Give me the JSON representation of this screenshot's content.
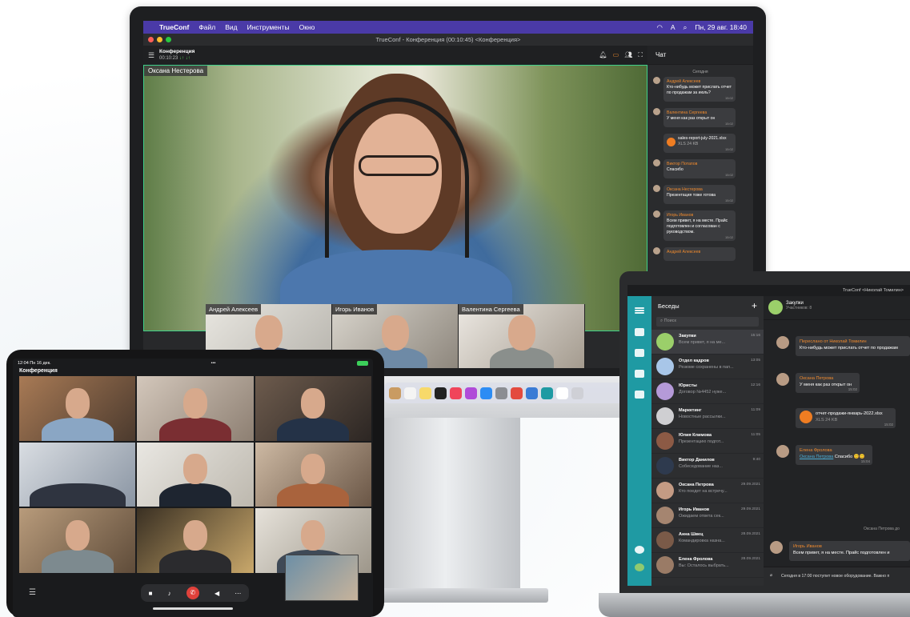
{
  "mac": {
    "menubar": {
      "app": "TrueConf",
      "menus": [
        "Файл",
        "Вид",
        "Инструменты",
        "Окно"
      ],
      "clock": "Пн, 29 авг. 18:40",
      "lang": "A"
    },
    "window_title": "TrueConf - Конференция (00:10:45) <Конференция>",
    "conference": {
      "title": "Конференция",
      "time": "00:10:23",
      "stats": "↓↑ ↓↑"
    },
    "main_speaker": "Оксана Нестерова",
    "thumbnails": [
      "Андрей Алексеев",
      "Игорь Иванов",
      "Валентина Сергеева"
    ],
    "chat": {
      "title": "Чат",
      "day": "Сегодня",
      "messages": [
        {
          "author": "Андрей Алексеев",
          "text": "Кто-нибудь может прислать отчет по продажам за июль?",
          "time": "15:02"
        },
        {
          "author": "Валентина Сергеева",
          "text": "У меня как раз открыт он",
          "time": "15:02"
        },
        {
          "author": "",
          "file": "sales-report-july-2021.xlsx",
          "size": "XLS 24 KB",
          "time": "15:02"
        },
        {
          "author": "Виктор Потапов",
          "text": "Спасибо",
          "time": "15:02"
        },
        {
          "author": "Оксана Нестерова",
          "text": "Презентация тоже готова",
          "time": "15:02"
        },
        {
          "author": "Игорь Иванов",
          "text": "Всем привет, я на месте. Прайс подготовлен и согласован с руководством.",
          "time": "15:02"
        },
        {
          "author": "Андрей Алексеев",
          "text": "",
          "time": ""
        }
      ]
    }
  },
  "laptop": {
    "title": "TrueConf <Николай Томилин>",
    "list_title": "Беседы",
    "search_placeholder": "Поиск",
    "conversations": [
      {
        "name": "Закупки",
        "preview": "Всем привет, я на ме...",
        "time": "15:16",
        "group": true
      },
      {
        "name": "Отдел кадров",
        "preview": "Резюме сохранены в пап...",
        "time": "13:05",
        "group": true
      },
      {
        "name": "Юристы",
        "preview": "Договор №4452 нуже...",
        "time": "12:16",
        "group": true
      },
      {
        "name": "Маркетинг",
        "preview": "Новостные рассылки...",
        "time": "11:09",
        "group": true
      },
      {
        "name": "Юлия Климова",
        "preview": "Презентацию подгот...",
        "time": "11:05",
        "group": false
      },
      {
        "name": "Виктор Данилов",
        "preview": "Собеседование наз...",
        "time": "9:40",
        "group": false
      },
      {
        "name": "Оксана Петрова",
        "preview": "Кто поедет на встречу...",
        "time": "29.09.2021",
        "group": false
      },
      {
        "name": "Игорь Иванов",
        "preview": "Ожидаем ответа сек...",
        "time": "29.09.2021",
        "group": false
      },
      {
        "name": "Анна Швец",
        "preview": "Командировка назна...",
        "time": "28.09.2021",
        "group": false
      },
      {
        "name": "Елена Фролова",
        "preview": "Вы: Осталось выбрать...",
        "time": "28.09.2021",
        "group": false
      }
    ],
    "chat": {
      "name": "Закупки",
      "members": "Участников: 8",
      "msg1_author": "Пересланo от Николай Томилин",
      "msg1_text": "Кто-нибудь может прислать отчет по продажам",
      "msg2_author": "Оксана Петрова",
      "msg2_text": "У меня как раз открыт он",
      "msg2_time": "15:02",
      "file_name": "отчет-продажи-январь-2022.xlsx",
      "file_size": "XLS 24 KB",
      "file_time": "15:02",
      "msg3_author": "Елена Фролова",
      "msg3_link": "Оксана Петрова",
      "msg3_text": "Спасибо 😊😊",
      "msg3_time": "15:04",
      "typing_note": "Оксана Петрова до",
      "msg4_author": "Игорь Иванов",
      "msg4_text": "Всем привет, я на месте. Прайс подготовлен и",
      "input_text": "Сегодня в 17:00 поступит новое оборудование. Важно п"
    }
  },
  "ipad": {
    "status_time": "12:04  Пн 16 дек.",
    "title": "Конференция",
    "dots": "•••"
  },
  "colors": {
    "mac_menubar": "#4a3aa7",
    "accent_teal": "#1f9aa3",
    "active_border": "#3fd08a",
    "hangup_red": "#e0413b",
    "author_orange": "#ef8a2e"
  }
}
